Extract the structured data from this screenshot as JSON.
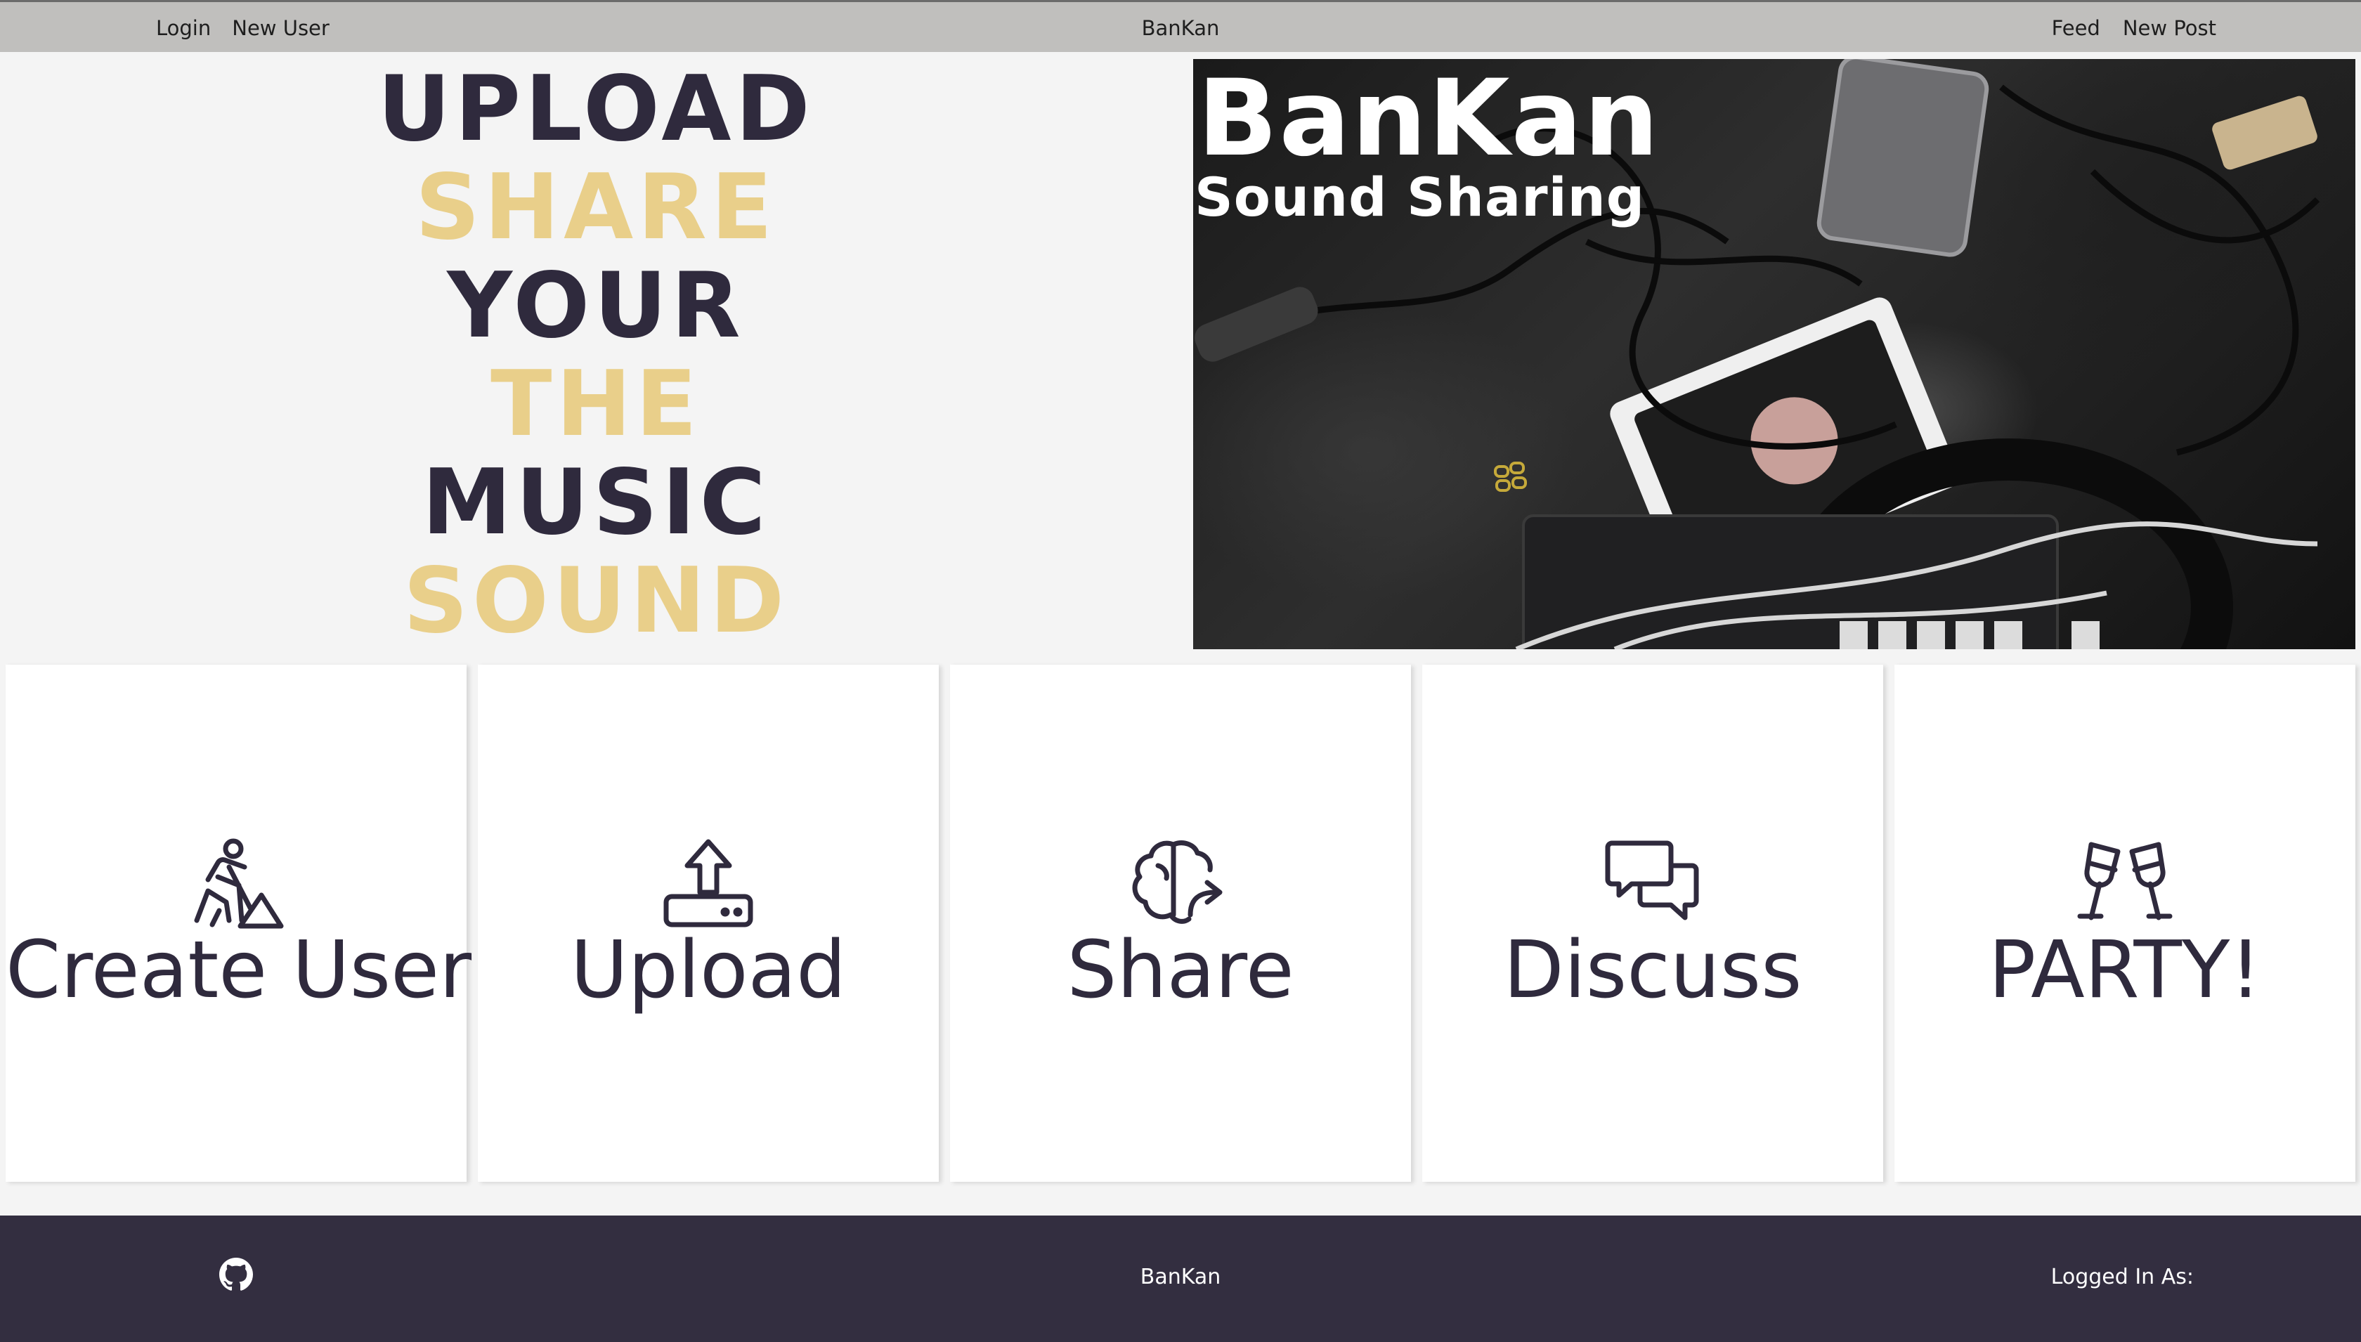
{
  "nav": {
    "left": [
      "Login",
      "New User"
    ],
    "brand": "BanKan",
    "right": [
      "Feed",
      "New Post"
    ]
  },
  "hero": {
    "words": [
      {
        "text": "UPLOAD",
        "color": "dark"
      },
      {
        "text": "SHARE",
        "color": "gold"
      },
      {
        "text": "YOUR",
        "color": "dark"
      },
      {
        "text": "THE",
        "color": "gold"
      },
      {
        "text": "MUSIC",
        "color": "dark"
      },
      {
        "text": "SOUND",
        "color": "gold"
      }
    ],
    "image_title": "BanKan",
    "image_subtitle": "Sound Sharing"
  },
  "cards": [
    {
      "label": "Create User",
      "icon": "worker-digging-icon"
    },
    {
      "label": "Upload",
      "icon": "upload-icon"
    },
    {
      "label": "Share",
      "icon": "brain-share-icon"
    },
    {
      "label": "Discuss",
      "icon": "chat-bubbles-icon"
    },
    {
      "label": "PARTY!",
      "icon": "champagne-glasses-icon"
    }
  ],
  "footer": {
    "brand": "BanKan",
    "logged_in": "Logged In As:",
    "icon": "github-icon"
  },
  "colors": {
    "dark": "#2f2a3d",
    "gold": "#e9cf8a",
    "navbar": "#c0bfbd",
    "footer": "#332e40"
  }
}
